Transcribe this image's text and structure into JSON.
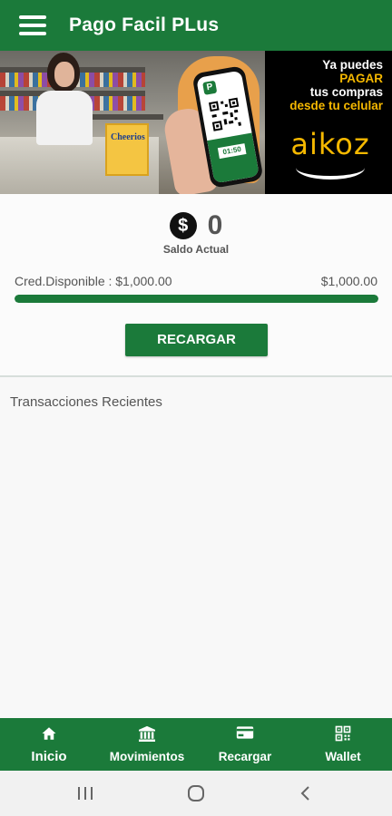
{
  "appbar": {
    "title": "Pago Facil PLus",
    "menu_icon": "hamburger-menu-icon"
  },
  "banner": {
    "promo_lines": [
      "Ya puedes",
      "PAGAR",
      "tus compras",
      "desde tu celular"
    ],
    "brand": "aikoz",
    "cereal_label": "Cheerios",
    "phone_code": "01:50",
    "colors": {
      "highlight": "#f5b800",
      "background": "#000000"
    }
  },
  "balance": {
    "currency_icon": "dollar-icon",
    "currency_symbol": "$",
    "amount": "0",
    "label": "Saldo Actual",
    "credit_label": "Cred.Disponible : $1,000.00",
    "credit_limit": "$1,000.00",
    "progress_fraction": 1.0
  },
  "actions": {
    "recharge_label": "RECARGAR"
  },
  "recent": {
    "title": "Transacciones Recientes"
  },
  "bottom_nav": {
    "items": [
      {
        "label": "Inicio",
        "icon": "home-icon",
        "active": true
      },
      {
        "label": "Movimientos",
        "icon": "bank-icon",
        "active": false
      },
      {
        "label": "Recargar",
        "icon": "credit-card-icon",
        "active": false
      },
      {
        "label": "Wallet",
        "icon": "qr-code-icon",
        "active": false
      }
    ]
  },
  "system_nav": {
    "icons": [
      "recents-icon",
      "home-circle-icon",
      "back-icon"
    ]
  },
  "colors": {
    "primary": "#1b7a3a",
    "text_muted": "#555555",
    "background": "#f8f8f8"
  }
}
